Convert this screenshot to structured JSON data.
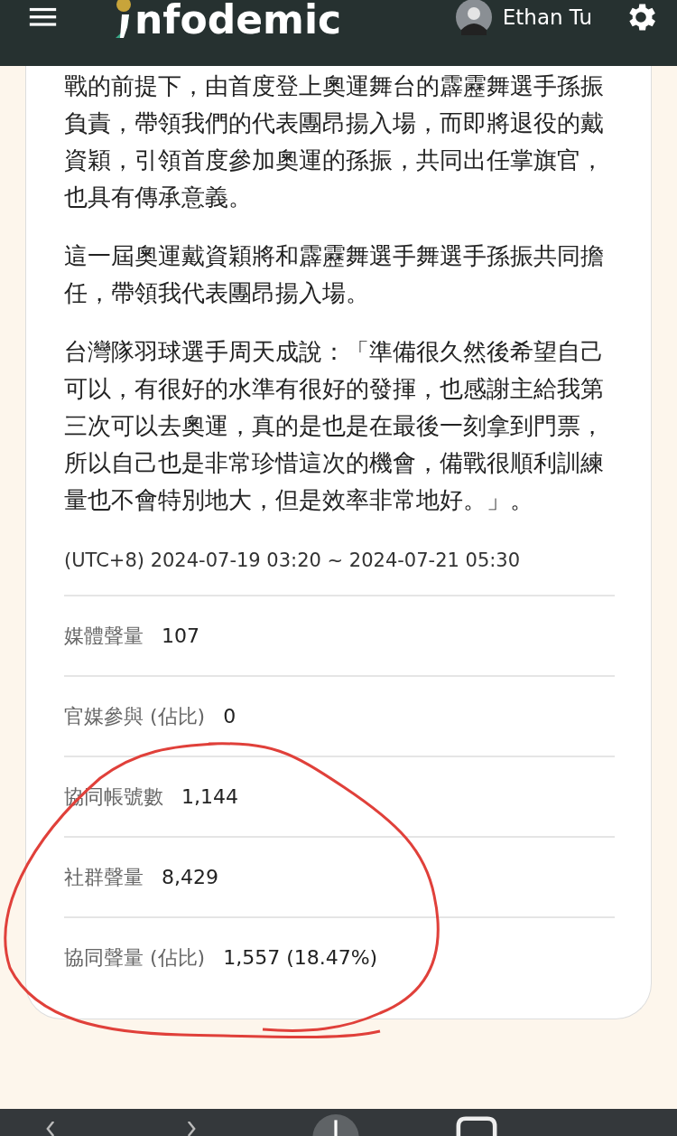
{
  "header": {
    "logo": "nfodemic",
    "user": "Ethan Tu"
  },
  "paragraphs": [
    "戰的前提下，由首度登上奧運舞台的霹靂舞選手孫振負責，帶領我們的代表團昂揚入場，而即將退役的戴資穎，引領首度參加奧運的孫振，共同出任掌旗官，也具有傳承意義。",
    "這一屆奧運戴資穎將和霹靂舞選手舞選手孫振共同擔任，帶領我代表團昂揚入場。",
    "台灣隊羽球選手周天成說：「準備很久然後希望自己可以，有很好的水準有很好的發揮，也感謝主給我第三次可以去奧運，真的是也是在最後一刻拿到門票，所以自己也是非常珍惜這次的機會，備戰很順利訓練量也不會特別地大，但是效率非常地好。」。"
  ],
  "period": "(UTC+8) 2024-07-19 03:20 ~ 2024-07-21 05:30",
  "stats": [
    {
      "label": "媒體聲量",
      "value": "107"
    },
    {
      "label": "官媒參與 (佔比)",
      "value": "0"
    },
    {
      "label": "協同帳號數",
      "value": "1,144"
    },
    {
      "label": "社群聲量",
      "value": "8,429"
    },
    {
      "label": "協同聲量 (佔比)",
      "value": "1,557 (18.47%)"
    }
  ]
}
